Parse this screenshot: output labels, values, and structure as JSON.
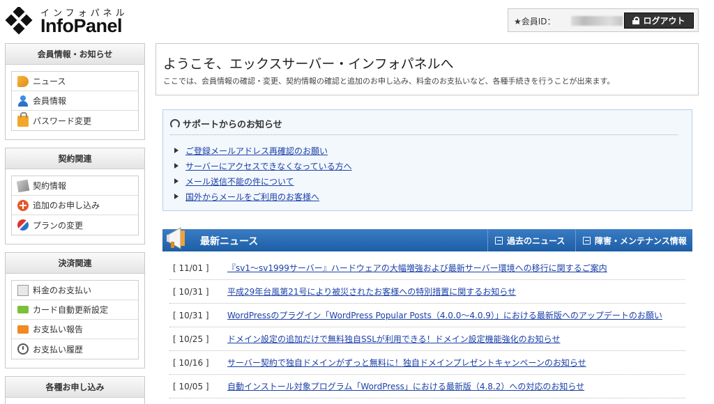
{
  "header": {
    "logo_kana": "インフォパネル",
    "logo_name": "InfoPanel",
    "member_label": "★会員ID：",
    "logout_label": "ログアウト"
  },
  "sidebar": {
    "sections": [
      {
        "title": "会員情報・お知らせ",
        "items": [
          {
            "label": "ニュース",
            "icon": "news-icon"
          },
          {
            "label": "会員情報",
            "icon": "user-icon"
          },
          {
            "label": "パスワード変更",
            "icon": "lock-icon"
          }
        ]
      },
      {
        "title": "契約関連",
        "items": [
          {
            "label": "契約情報",
            "icon": "contract-icon"
          },
          {
            "label": "追加のお申し込み",
            "icon": "add-icon"
          },
          {
            "label": "プランの変更",
            "icon": "plan-change-icon"
          }
        ]
      },
      {
        "title": "決済関連",
        "items": [
          {
            "label": "料金のお支払い",
            "icon": "bill-icon"
          },
          {
            "label": "カード自動更新設定",
            "icon": "card-icon"
          },
          {
            "label": "お支払い報告",
            "icon": "report-icon"
          },
          {
            "label": "お支払い履歴",
            "icon": "history-icon"
          }
        ]
      },
      {
        "title": "各種お申し込み",
        "items": []
      }
    ]
  },
  "welcome": {
    "title": "ようこそ、エックスサーバー・インフォパネルへ",
    "description": "ここでは、会員情報の確認・変更、契約情報の確認と追加のお申し込み、料金のお支払いなど、各種手続きを行うことが出来ます。"
  },
  "support": {
    "title": "サポートからのお知らせ",
    "items": [
      "ご登録メールアドレス再確認のお願い",
      "サーバーにアクセスできなくなっている方へ",
      "メール送信不能の件について",
      "国外からメールをご利用のお客様へ"
    ]
  },
  "news": {
    "title": "最新ニュース",
    "tab_past": "過去のニュース",
    "tab_maintenance": "障害・メンテナンス情報",
    "items": [
      {
        "date": "[ 11/01 ]",
        "text": "『sv1〜sv1999サーバー』ハードウェアの大幅増強および最新サーバー環境への移行に関するご案内"
      },
      {
        "date": "[ 10/31 ]",
        "text": "平成29年台風第21号により被災されたお客様への特別措置に関するお知らせ"
      },
      {
        "date": "[ 10/31 ]",
        "text": "WordPressのプラグイン「WordPress Popular Posts（4.0.0〜4.0.9）」における最新版へのアップデートのお願い"
      },
      {
        "date": "[ 10/25 ]",
        "text": "ドメイン設定の追加だけで無料独自SSLが利用できる！ドメイン設定機能強化のお知らせ"
      },
      {
        "date": "[ 10/16 ]",
        "text": "サーバー契約で独自ドメインがずっと無料に！独自ドメインプレゼントキャンペーンのお知らせ"
      },
      {
        "date": "[ 10/05 ]",
        "text": "自動インストール対象プログラム「WordPress」における最新版（4.8.2）への対応のお知らせ"
      }
    ]
  },
  "colors": {
    "accent_blue": "#1d5ea6",
    "link_blue": "#1a3fa8",
    "support_bg": "#f3f8fd"
  }
}
